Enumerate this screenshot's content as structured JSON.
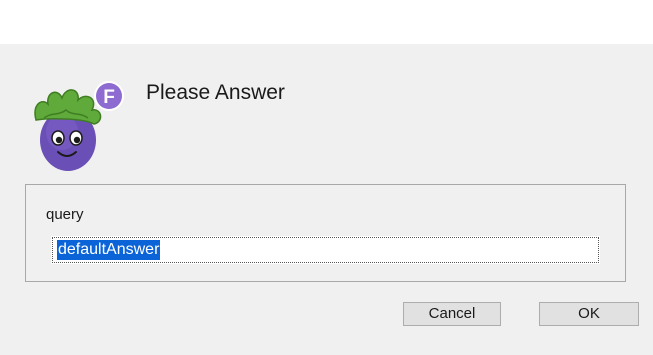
{
  "dialog": {
    "title": "Please Answer",
    "logo_icon": "eggplant-mascot-icon",
    "logo_badge": "F",
    "query_label": "query",
    "answer_value": "defaultAnswer",
    "buttons": {
      "cancel_label": "Cancel",
      "ok_label": "OK"
    }
  },
  "colors": {
    "dialog_bg": "#f0f0f0",
    "selection": "#0a64d8",
    "eggplant_purple": "#6a4fb6",
    "leaf_green": "#5faa3a",
    "badge_purple": "#8e6bd0"
  }
}
